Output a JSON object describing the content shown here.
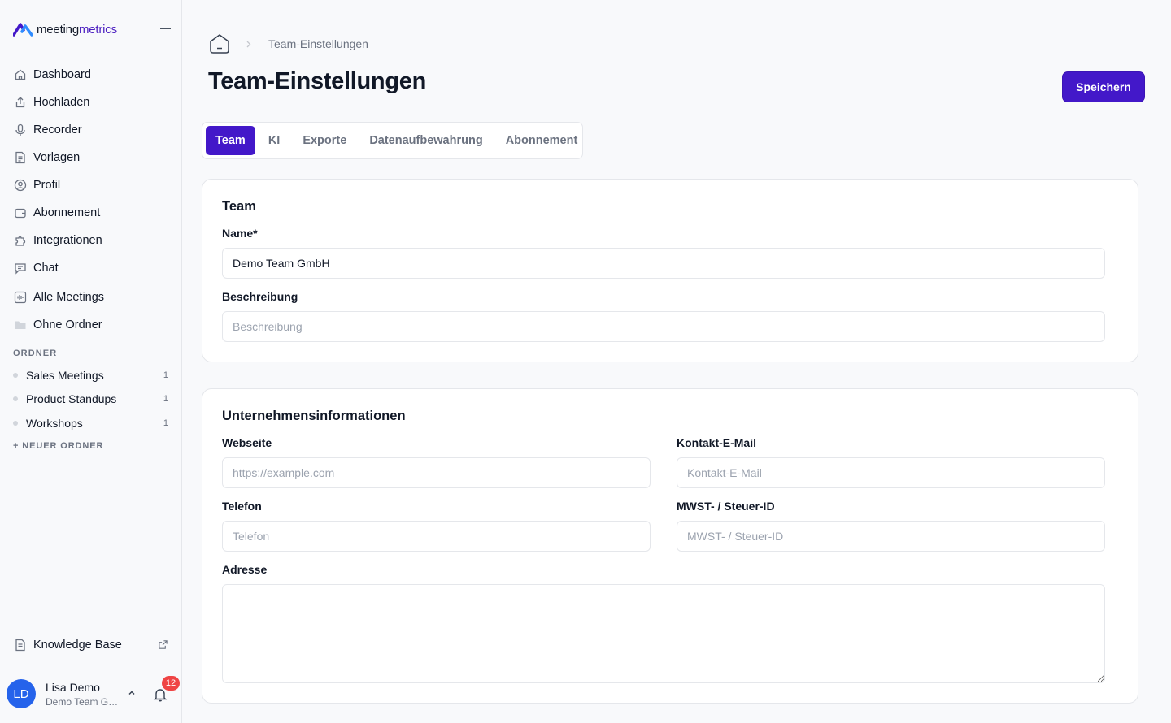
{
  "brand": {
    "name_part1": "meeting",
    "name_part2": "metrics",
    "accent_color": "#4318c9"
  },
  "sidebar": {
    "nav": [
      {
        "label": "Dashboard",
        "icon": "home-icon"
      },
      {
        "label": "Hochladen",
        "icon": "upload-icon"
      },
      {
        "label": "Recorder",
        "icon": "microphone-icon"
      },
      {
        "label": "Vorlagen",
        "icon": "template-icon"
      },
      {
        "label": "Profil",
        "icon": "profile-icon"
      },
      {
        "label": "Abonnement",
        "icon": "wallet-icon"
      },
      {
        "label": "Integrationen",
        "icon": "puzzle-icon"
      },
      {
        "label": "Chat",
        "icon": "chat-icon"
      },
      {
        "label": "Alle Meetings",
        "icon": "audio-wave-icon"
      },
      {
        "label": "Ohne Ordner",
        "icon": "folder-icon"
      }
    ],
    "ordner_title": "ORDNER",
    "folders": [
      {
        "name": "Sales Meetings",
        "count": "1"
      },
      {
        "name": "Product Standups",
        "count": "1"
      },
      {
        "name": "Workshops",
        "count": "1"
      }
    ],
    "new_folder": "+ NEUER ORDNER",
    "knowledge_base": "Knowledge Base",
    "user": {
      "initials": "LD",
      "name": "Lisa Demo",
      "team": "Demo Team GmbH"
    },
    "notifications": "12"
  },
  "breadcrumb": {
    "current": "Team-Einstellungen"
  },
  "page_title": "Team-Einstellungen",
  "save_label": "Speichern",
  "tabs": [
    {
      "label": "Team",
      "active": true
    },
    {
      "label": "KI",
      "active": false
    },
    {
      "label": "Exporte",
      "active": false
    },
    {
      "label": "Datenaufbewahrung",
      "active": false
    },
    {
      "label": "Abonnement",
      "active": false
    }
  ],
  "team_card": {
    "title": "Team",
    "name_label": "Name*",
    "name_value": "Demo Team GmbH",
    "description_label": "Beschreibung",
    "description_placeholder": "Beschreibung"
  },
  "company_card": {
    "title": "Unternehmensinformationen",
    "website_label": "Webseite",
    "website_placeholder": "https://example.com",
    "email_label": "Kontakt-E-Mail",
    "email_placeholder": "Kontakt-E-Mail",
    "phone_label": "Telefon",
    "phone_placeholder": "Telefon",
    "tax_label": "MWST- / Steuer-ID",
    "tax_placeholder": "MWST- / Steuer-ID",
    "address_label": "Adresse"
  }
}
